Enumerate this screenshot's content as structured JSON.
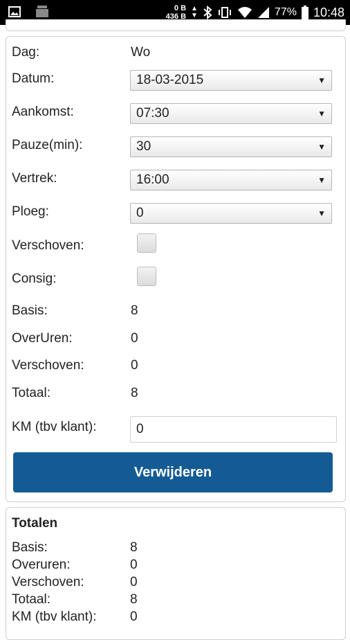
{
  "status_bar": {
    "data_up": "0 B",
    "data_down": "436 B",
    "battery": "77%",
    "time": "10:48",
    "icons": [
      "image-icon",
      "sim-icon",
      "bluetooth-icon",
      "vibrate-icon",
      "wifi-icon",
      "signal-icon",
      "battery-icon"
    ]
  },
  "form": {
    "dag": {
      "label": "Dag:",
      "value": "Wo"
    },
    "datum": {
      "label": "Datum:",
      "value": "18-03-2015"
    },
    "aankomst": {
      "label": "Aankomst:",
      "value": "07:30"
    },
    "pauze": {
      "label": "Pauze(min):",
      "value": "30"
    },
    "vertrek": {
      "label": "Vertrek:",
      "value": "16:00"
    },
    "ploeg": {
      "label": "Ploeg:",
      "value": "0"
    },
    "verschoven_chk": {
      "label": "Verschoven:",
      "checked": false
    },
    "consig": {
      "label": "Consig:",
      "checked": false
    },
    "basis": {
      "label": "Basis:",
      "value": "8"
    },
    "overuren": {
      "label": "OverUren:",
      "value": "0"
    },
    "verschoven": {
      "label": "Verschoven:",
      "value": "0"
    },
    "totaal": {
      "label": "Totaal:",
      "value": "8"
    },
    "km": {
      "label": "KM (tbv klant):",
      "value": "0"
    },
    "delete_button": "Verwijderen"
  },
  "totals": {
    "title": "Totalen",
    "rows": [
      {
        "label": "Basis:",
        "value": "8"
      },
      {
        "label": "Overuren:",
        "value": "0"
      },
      {
        "label": "Verschoven:",
        "value": "0"
      },
      {
        "label": "Totaal:",
        "value": "8"
      },
      {
        "label": "KM (tbv klant):",
        "value": "0"
      }
    ]
  },
  "colors": {
    "button": "#155b93",
    "statusbar": "#000000"
  }
}
